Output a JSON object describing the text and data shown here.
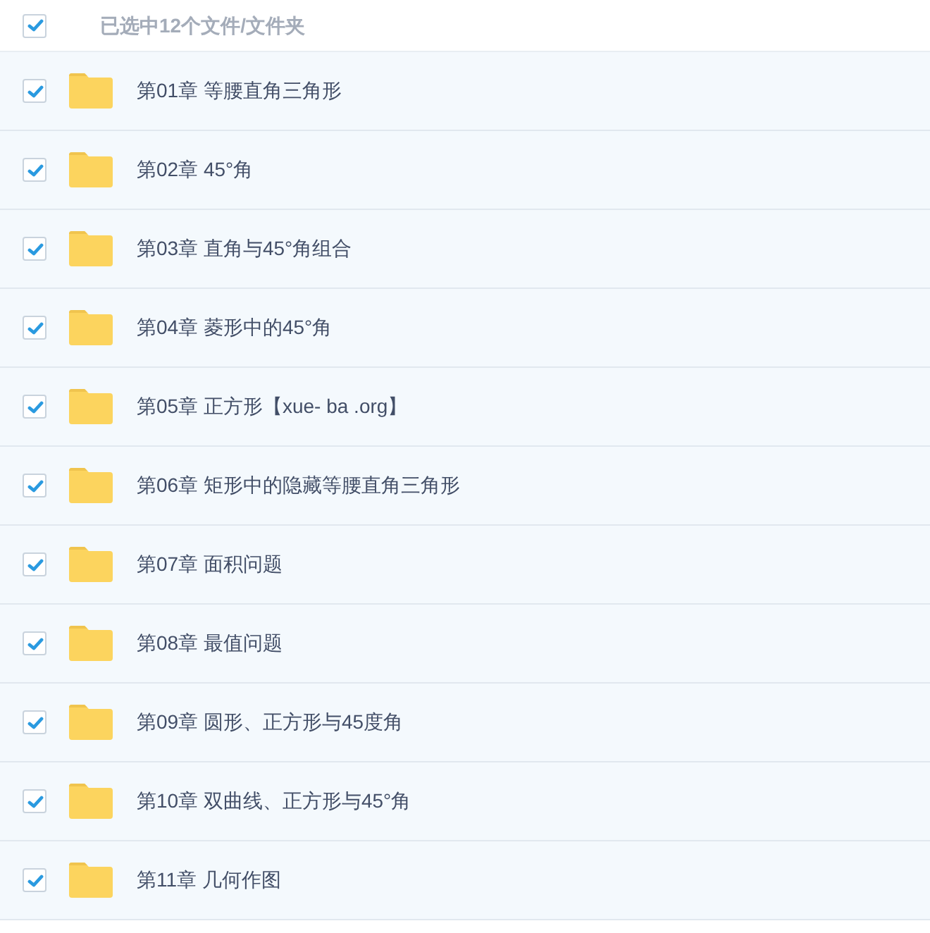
{
  "header": {
    "checked": true,
    "label": "已选中12个文件/文件夹"
  },
  "files": [
    {
      "name": "第01章 等腰直角三角形",
      "checked": true
    },
    {
      "name": "第02章 45°角",
      "checked": true
    },
    {
      "name": "第03章 直角与45°角组合",
      "checked": true
    },
    {
      "name": "第04章 菱形中的45°角",
      "checked": true
    },
    {
      "name": "第05章 正方形【xue- ba .org】",
      "checked": true
    },
    {
      "name": "第06章 矩形中的隐藏等腰直角三角形",
      "checked": true
    },
    {
      "name": "第07章 面积问题",
      "checked": true
    },
    {
      "name": "第08章 最值问题",
      "checked": true
    },
    {
      "name": "第09章 圆形、正方形与45度角",
      "checked": true
    },
    {
      "name": "第10章 双曲线、正方形与45°角",
      "checked": true
    },
    {
      "name": "第11章 几何作图",
      "checked": true
    }
  ]
}
